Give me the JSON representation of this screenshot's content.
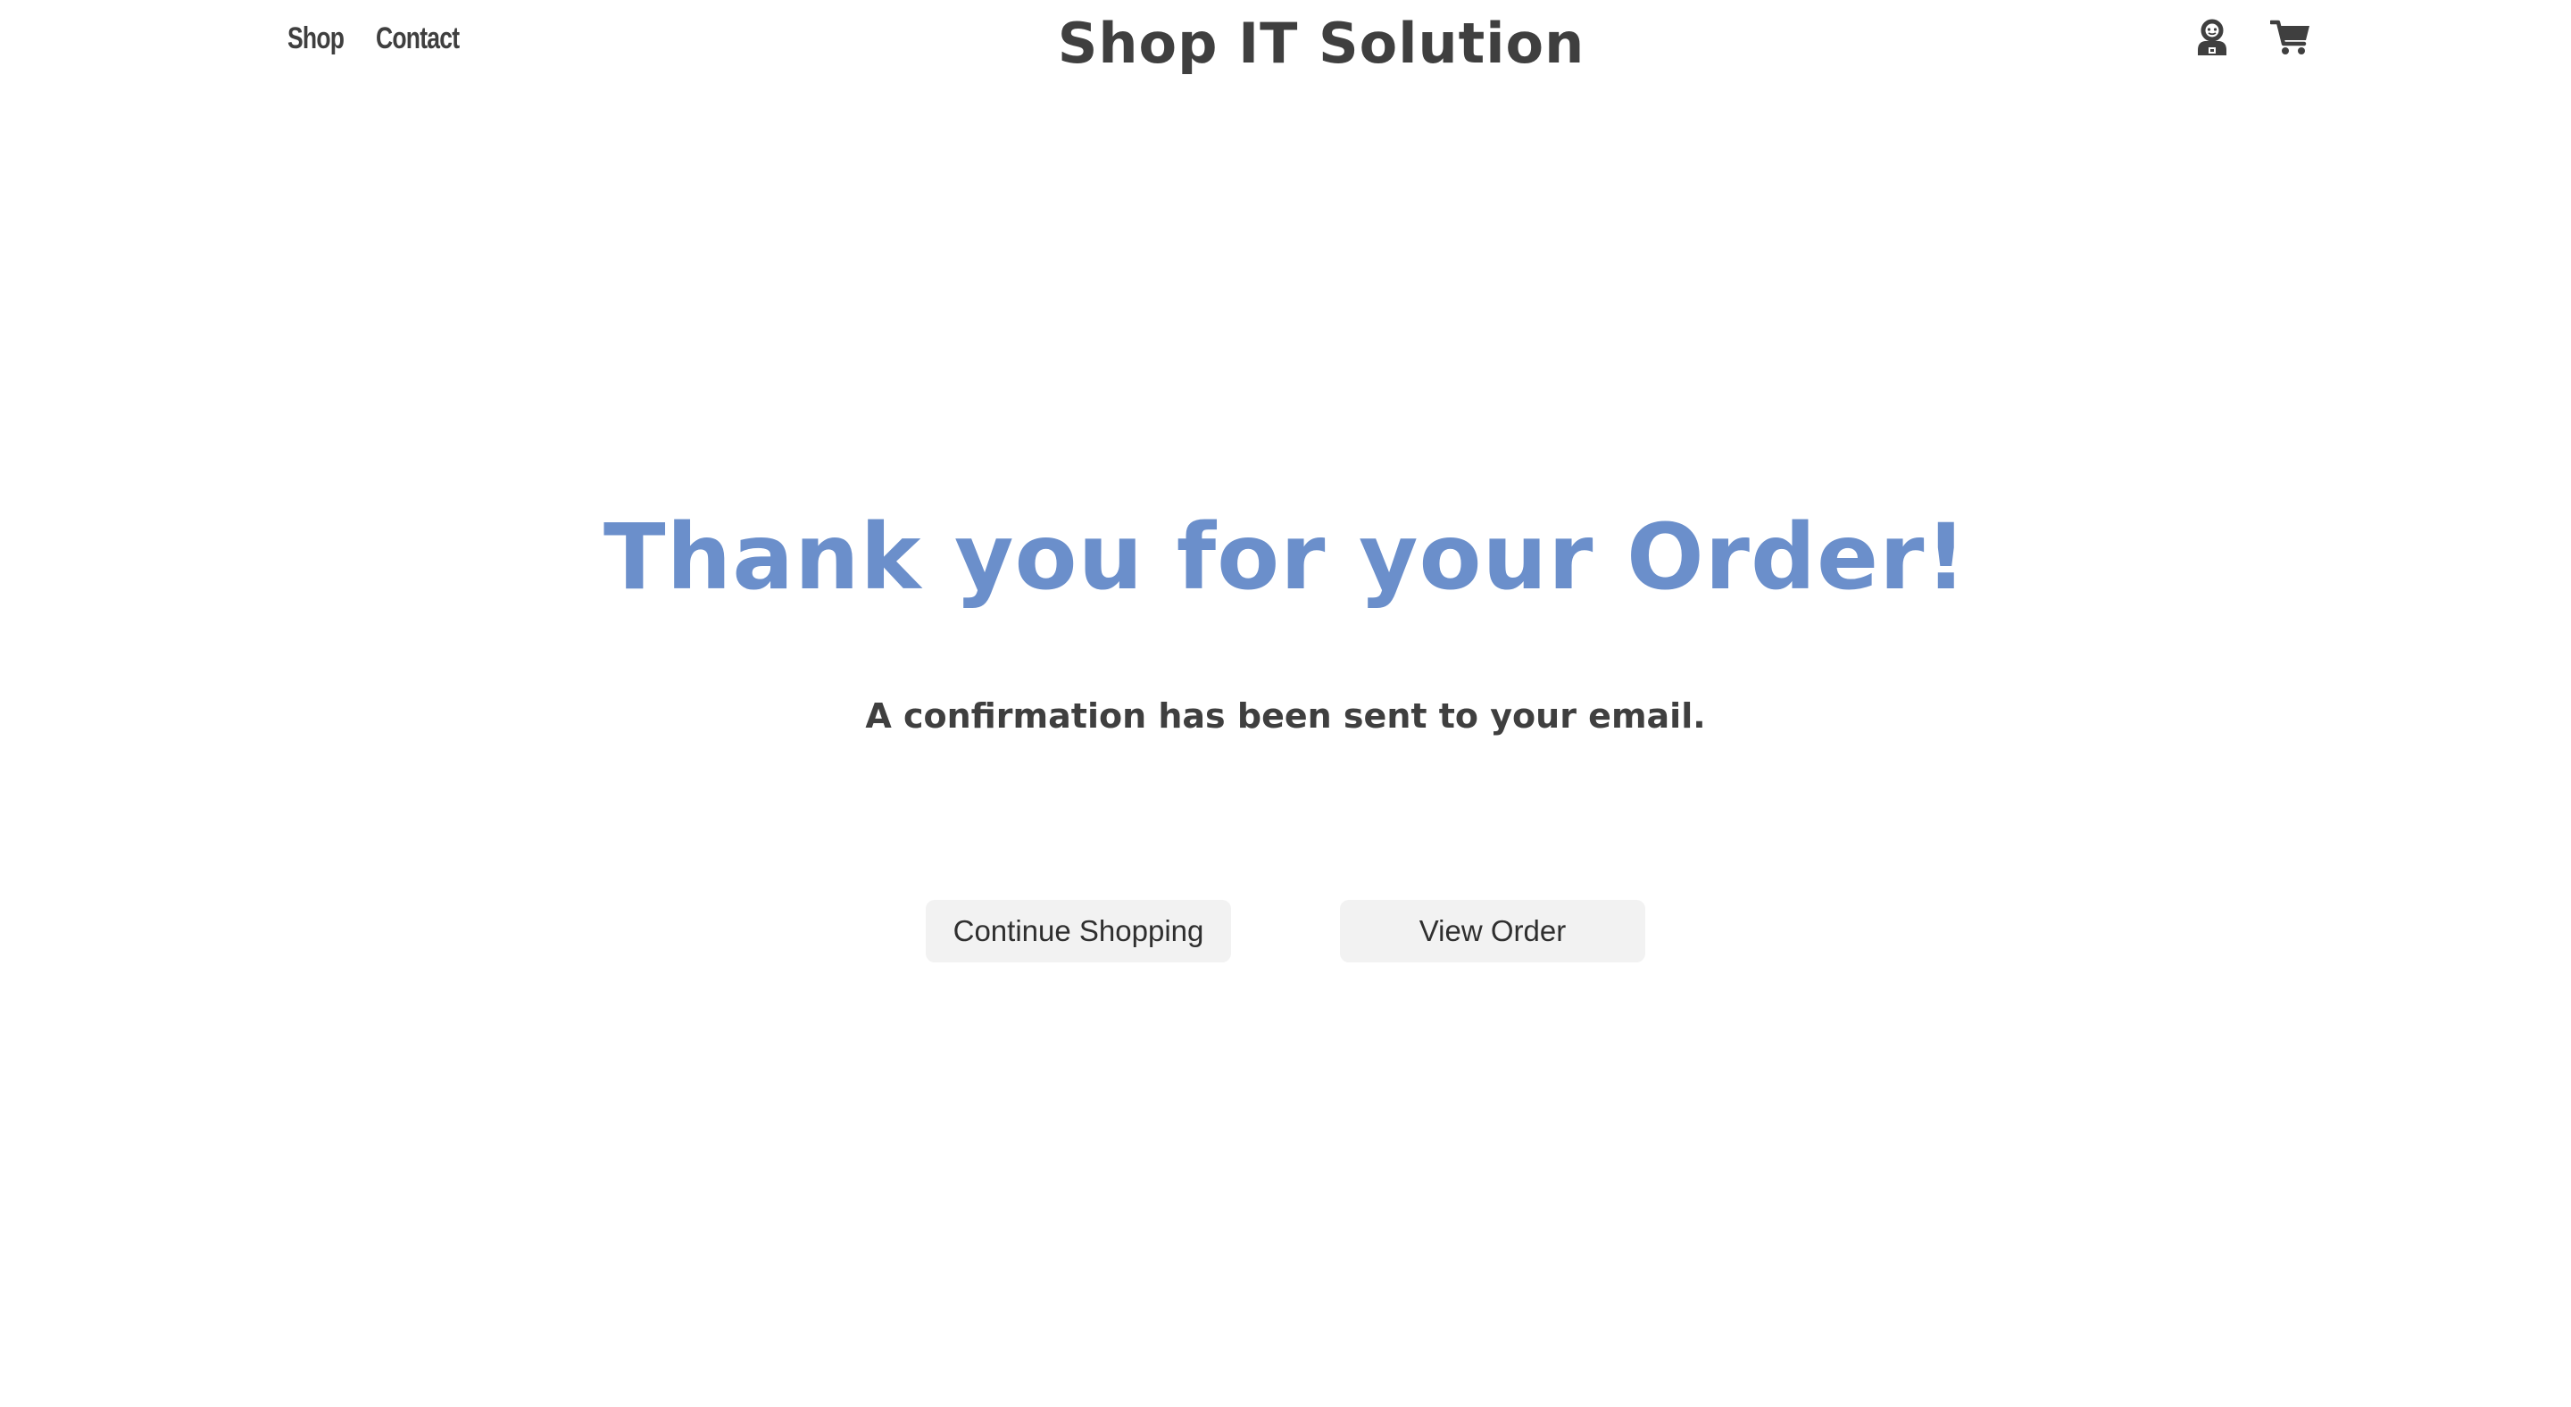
{
  "header": {
    "nav": [
      {
        "label": "Shop"
      },
      {
        "label": "Contact"
      }
    ],
    "title": "Shop IT Solution",
    "icons": {
      "account": "user-account-icon",
      "cart": "shopping-cart-icon"
    }
  },
  "confirmation": {
    "heading": "Thank you for your Order!",
    "message": "A confirmation has been sent to your email.",
    "continue_label": "Continue Shopping",
    "view_order_label": "View Order"
  },
  "colors": {
    "accent": "#6b8fcb",
    "text": "#3f3f3f",
    "button_bg": "#f2f2f2"
  }
}
